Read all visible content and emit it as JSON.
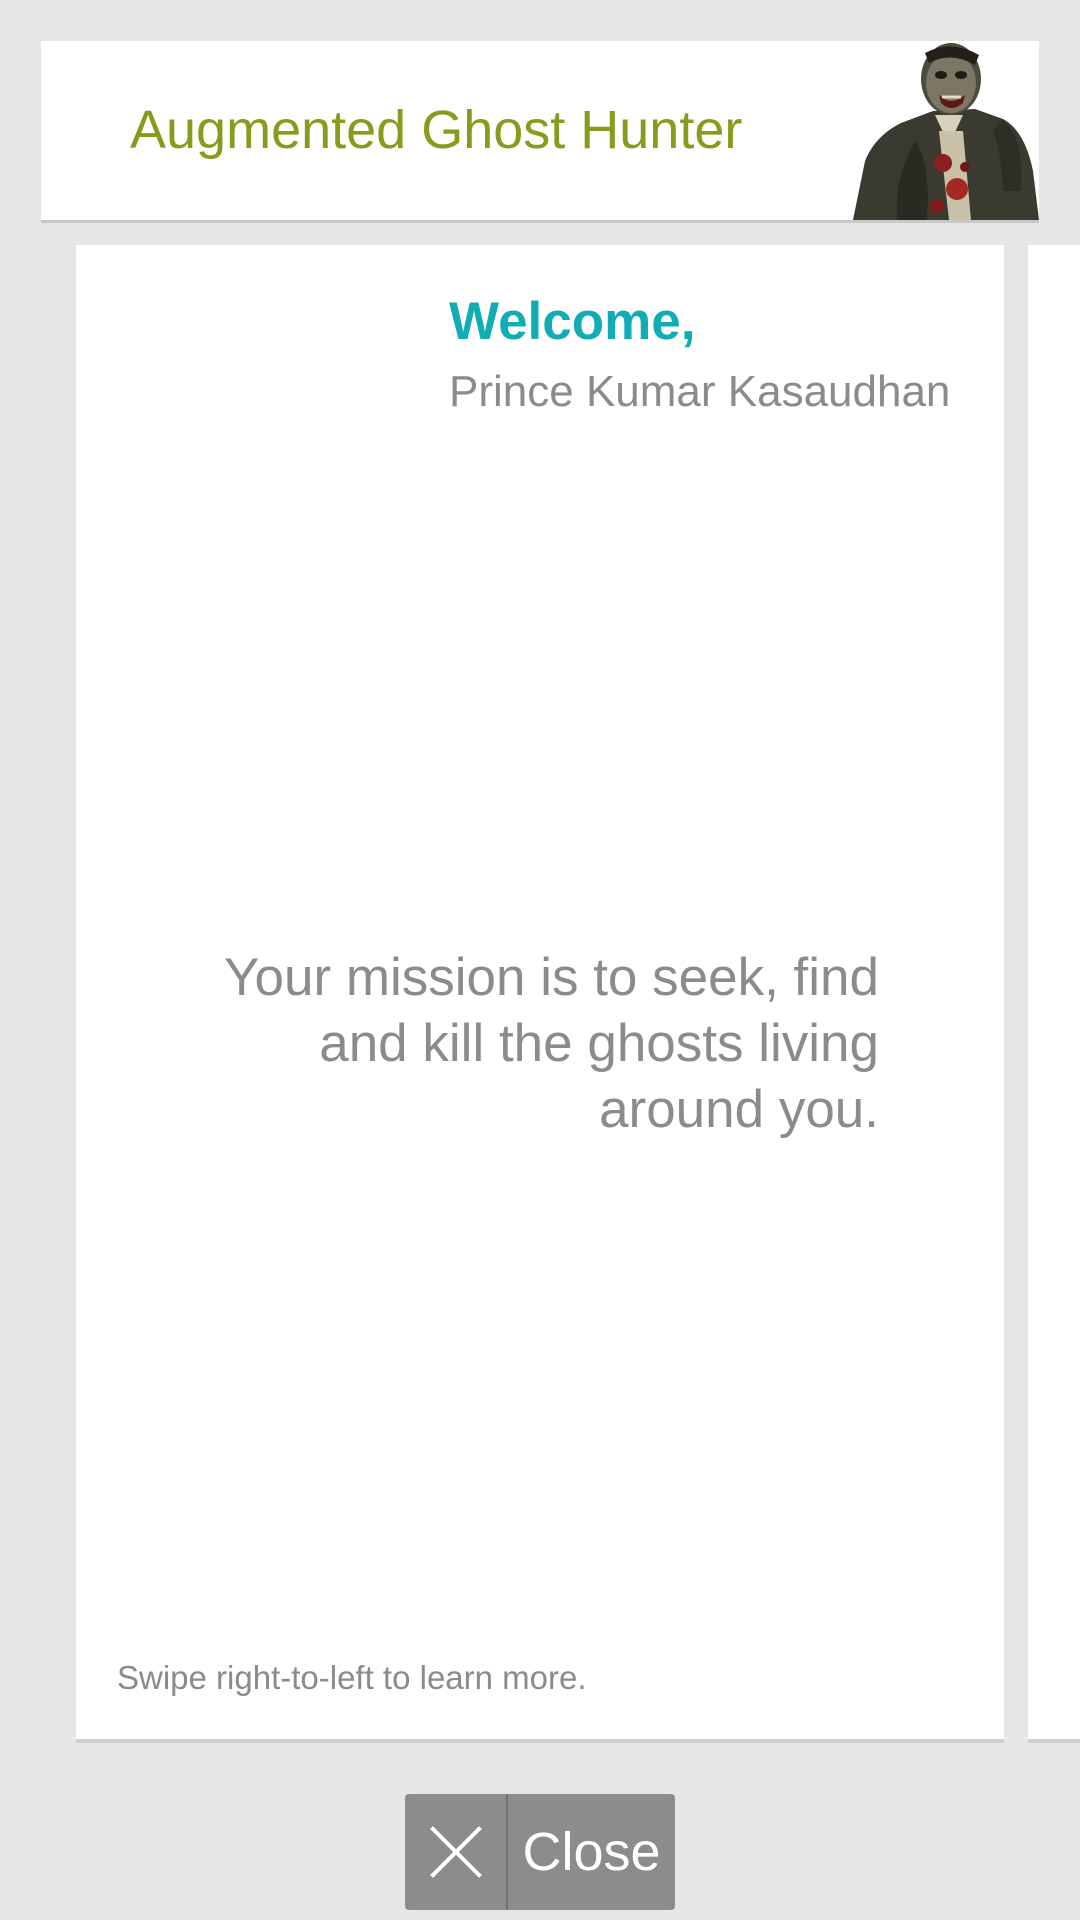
{
  "header": {
    "title": "Augmented Ghost Hunter",
    "image_icon": "zombie-character-image"
  },
  "welcome_card": {
    "greeting": "Welcome,",
    "user_name": "Prince Kumar Kasaudhan",
    "mission_line_1": "Your mission is to seek, find",
    "mission_line_2": "and kill the ghosts living",
    "mission_line_3": "around you.",
    "swipe_hint": "Swipe right-to-left to learn more."
  },
  "close_button": {
    "icon": "close-icon",
    "label": "Close"
  },
  "colors": {
    "background": "#e6e6e6",
    "title_green": "#8a9a1c",
    "welcome_teal": "#12acb4",
    "text_grey": "#8b8b8b",
    "button_grey": "#8c8c8c"
  }
}
